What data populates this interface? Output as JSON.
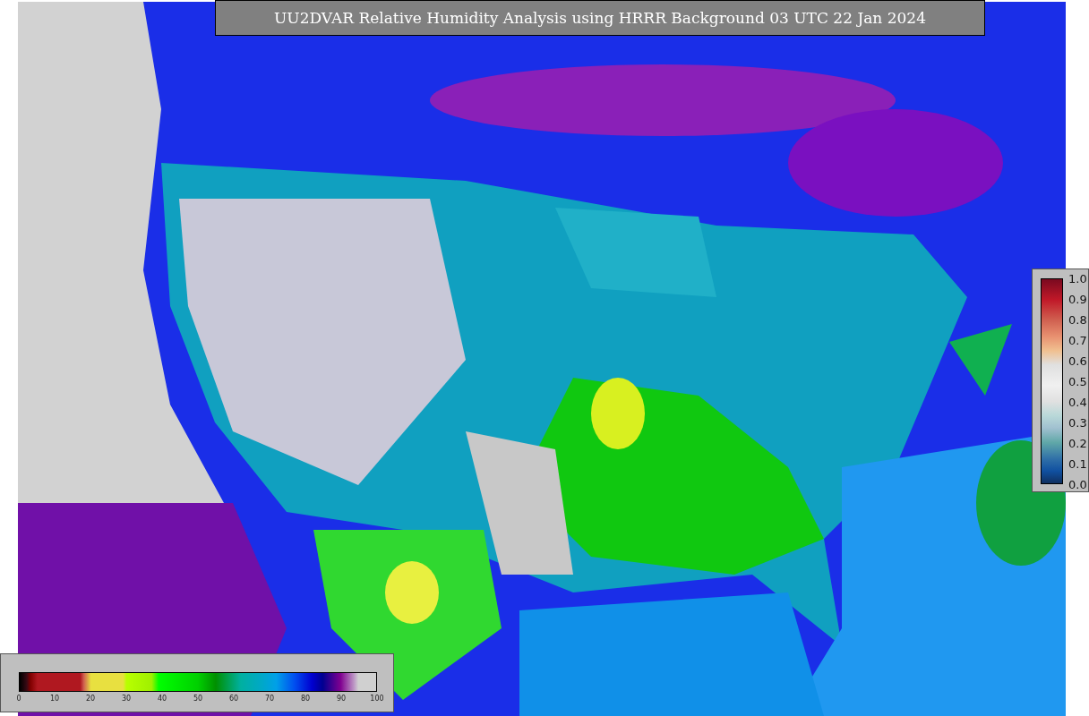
{
  "title": "UU2DVAR Relative Humidity Analysis using HRRR Background 03 UTC 22 Jan 2024",
  "humidity_colorbar": {
    "ticks": [
      "0",
      "10",
      "20",
      "30",
      "40",
      "50",
      "60",
      "70",
      "80",
      "90",
      "100"
    ]
  },
  "station_colorbar": {
    "ticks": [
      "1.0",
      "0.9",
      "0.8",
      "0.7",
      "0.6",
      "0.5",
      "0.4",
      "0.3",
      "0.2",
      "0.1",
      "0.0"
    ]
  }
}
